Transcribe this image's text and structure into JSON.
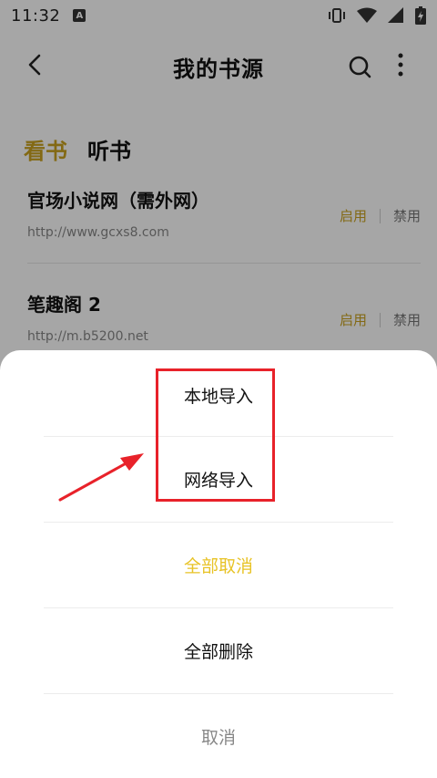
{
  "status_bar": {
    "time": "11:32",
    "badge": "A",
    "icons": [
      "vibrate-icon",
      "wifi-icon",
      "signal-icon",
      "battery-icon"
    ]
  },
  "header": {
    "title": "我的书源",
    "icons": [
      "back-arrow-icon",
      "search-icon",
      "more-vertical-icon"
    ]
  },
  "tabs": [
    {
      "label": "看书",
      "active": true
    },
    {
      "label": "听书",
      "active": false
    }
  ],
  "sources": [
    {
      "name": "官场小说网（需外网）",
      "url": "http://www.gcxs8.com",
      "enable_label": "启用",
      "disable_label": "禁用"
    },
    {
      "name": "笔趣阁 2",
      "url": "http://m.b5200.net",
      "enable_label": "启用",
      "disable_label": "禁用"
    }
  ],
  "bottom_sheet": {
    "items": [
      {
        "label": "本地导入",
        "style": "normal"
      },
      {
        "label": "网络导入",
        "style": "normal"
      },
      {
        "label": "全部取消",
        "style": "accent"
      },
      {
        "label": "全部删除",
        "style": "normal"
      },
      {
        "label": "取消",
        "style": "muted"
      }
    ]
  },
  "colors": {
    "accent": "#c9a21f",
    "sheet_accent": "#e8c326",
    "annotation": "#e8222a"
  }
}
